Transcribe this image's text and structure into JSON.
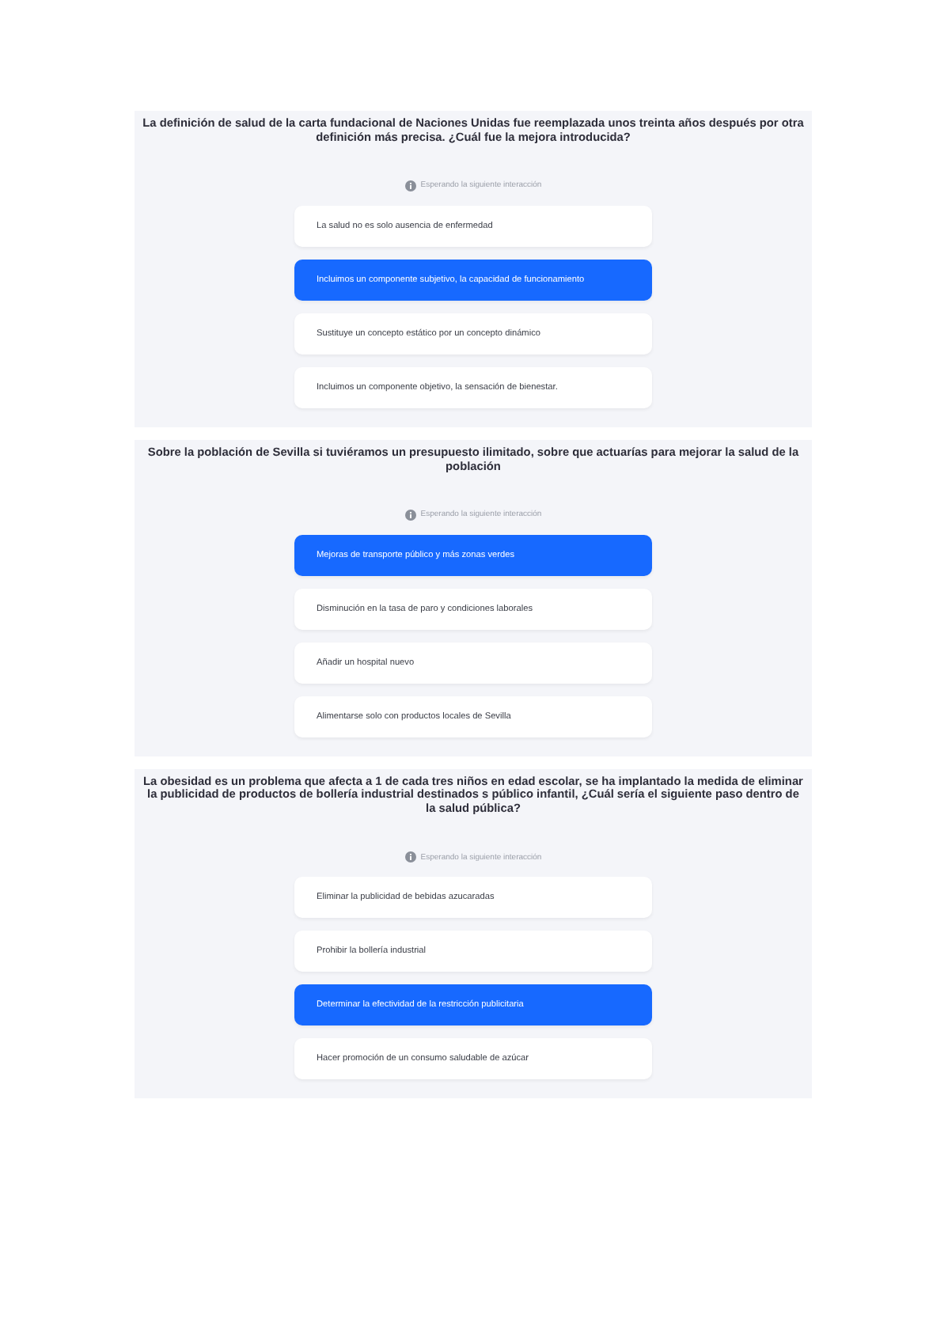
{
  "questions": [
    {
      "title": "La definición de salud de la carta fundacional de Naciones Unidas fue reemplazada unos treinta años después por otra definición más precisa. ¿Cuál fue la mejora introducida?",
      "status": "Esperando la siguiente interacción",
      "options": [
        {
          "label": "La salud no es solo ausencia de enfermedad",
          "selected": false
        },
        {
          "label": "Incluimos un componente subjetivo, la capacidad de funcionamiento",
          "selected": true
        },
        {
          "label": "Sustituye un concepto estático por un concepto dinámico",
          "selected": false
        },
        {
          "label": "Incluimos un componente objetivo, la sensación de bienestar.",
          "selected": false
        }
      ]
    },
    {
      "title": "Sobre la población de Sevilla si tuviéramos un presupuesto ilimitado, sobre que actuarías para mejorar la salud de la población",
      "status": "Esperando la siguiente interacción",
      "options": [
        {
          "label": "Mejoras de transporte público y más zonas verdes",
          "selected": true
        },
        {
          "label": "Disminución en la tasa de paro y condiciones laborales",
          "selected": false
        },
        {
          "label": "Añadir un hospital nuevo",
          "selected": false
        },
        {
          "label": "Alimentarse solo con productos locales de Sevilla",
          "selected": false
        }
      ]
    },
    {
      "title": "La obesidad es un problema que afecta a 1 de cada tres niños en edad escolar, se ha implantado la medida de eliminar la publicidad de productos de bollería industrial destinados s público infantil, ¿Cuál sería el siguiente paso dentro de la salud pública?",
      "status": "Esperando la siguiente interacción",
      "options": [
        {
          "label": "Eliminar la publicidad de bebidas azucaradas",
          "selected": false
        },
        {
          "label": "Prohibir la bollería industrial",
          "selected": false
        },
        {
          "label": "Determinar la efectividad de la restricción publicitaria",
          "selected": true
        },
        {
          "label": "Hacer promoción de un consumo saludable de azúcar",
          "selected": false
        }
      ]
    }
  ]
}
